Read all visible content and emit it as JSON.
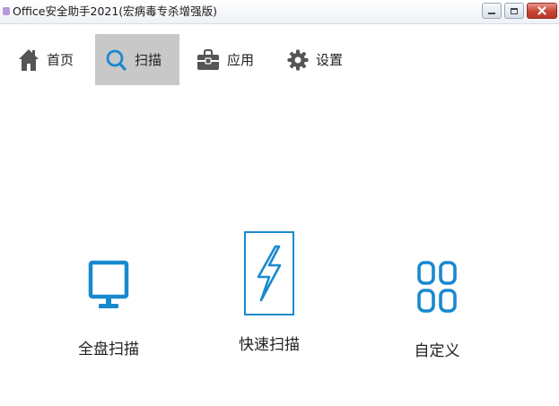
{
  "window": {
    "title": "Office安全助手2021(宏病毒专杀增强版)",
    "icon": "app-icon",
    "controls": [
      "minimize-icon",
      "maximize-icon",
      "close-icon"
    ]
  },
  "nav": {
    "items": [
      {
        "label": "首页",
        "icon": "home-icon",
        "active": false
      },
      {
        "label": "扫描",
        "icon": "search-icon",
        "active": true
      },
      {
        "label": "应用",
        "icon": "toolbox-icon",
        "active": false
      },
      {
        "label": "设置",
        "icon": "gear-icon",
        "active": false
      }
    ]
  },
  "scan_options": [
    {
      "label": "全盘扫描",
      "icon": "monitor-icon"
    },
    {
      "label": "快速扫描",
      "icon": "lightning-icon"
    },
    {
      "label": "自定义",
      "icon": "grid-icon"
    }
  ],
  "colors": {
    "accent": "#1989cf",
    "nav_icon": "#555555",
    "active_tab_bg": "#c8c8c8",
    "close_button": "#c74434"
  }
}
